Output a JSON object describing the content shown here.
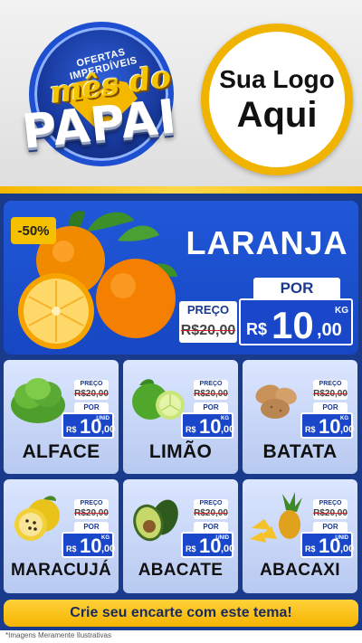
{
  "colors": {
    "brand_blue": "#1a47c9",
    "accent_yellow": "#f5b800",
    "card_bg": "#dbe6ff"
  },
  "header": {
    "campaign_tagline": "OFERTAS IMPERDÍVEIS",
    "campaign_script": "mês do",
    "campaign_title": "PAPAI",
    "logo_line1": "Sua Logo",
    "logo_line2": "Aqui"
  },
  "hero": {
    "discount_badge": "-50%",
    "product_name": "LARANJA",
    "product_icon": "orange-fruit-icon",
    "price_old_label": "PREÇO",
    "price_old": "R$20,00",
    "price_new_label": "POR",
    "price_new_currency": "R$",
    "price_new_integer": "10",
    "price_new_cents": ",00",
    "price_new_unit": "KG"
  },
  "products": [
    {
      "name": "ALFACE",
      "icon": "lettuce-icon",
      "old_label": "PREÇO",
      "old_price": "R$20,00",
      "new_label": "POR",
      "currency": "R$",
      "integer": "10",
      "cents": ",00",
      "unit": "UNID"
    },
    {
      "name": "LIMÃO",
      "icon": "lime-icon",
      "old_label": "PREÇO",
      "old_price": "R$20,00",
      "new_label": "POR",
      "currency": "R$",
      "integer": "10",
      "cents": ",00",
      "unit": "KG"
    },
    {
      "name": "BATATA",
      "icon": "potato-icon",
      "old_label": "PREÇO",
      "old_price": "R$20,00",
      "new_label": "POR",
      "currency": "R$",
      "integer": "10",
      "cents": ",00",
      "unit": "KG"
    },
    {
      "name": "MARACUJÁ",
      "icon": "passion-fruit-icon",
      "old_label": "PREÇO",
      "old_price": "R$20,00",
      "new_label": "POR",
      "currency": "R$",
      "integer": "10",
      "cents": ",00",
      "unit": "KG"
    },
    {
      "name": "ABACATE",
      "icon": "avocado-icon",
      "old_label": "PREÇO",
      "old_price": "R$20,00",
      "new_label": "POR",
      "currency": "R$",
      "integer": "10",
      "cents": ",00",
      "unit": "UNID"
    },
    {
      "name": "ABACAXI",
      "icon": "pineapple-icon",
      "old_label": "PREÇO",
      "old_price": "R$20,00",
      "new_label": "POR",
      "currency": "R$",
      "integer": "10",
      "cents": ",00",
      "unit": "UNID"
    }
  ],
  "footer": {
    "cta": "Crie seu encarte com este tema!",
    "disclaimer": "*Imagens Meramente Ilustrativas"
  }
}
